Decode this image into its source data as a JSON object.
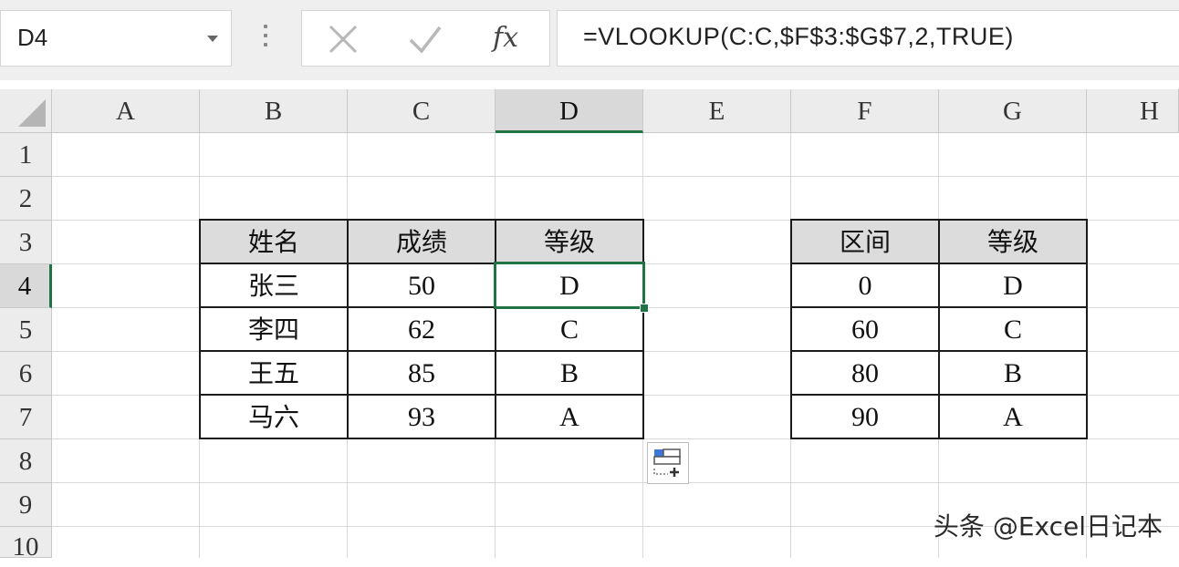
{
  "formula_bar": {
    "name_box": "D4",
    "fx_label": "fx",
    "formula": "=VLOOKUP(C:C,$F$3:$G$7,2,TRUE)"
  },
  "columns": [
    "A",
    "B",
    "C",
    "D",
    "E",
    "F",
    "G",
    "H"
  ],
  "rows": [
    "1",
    "2",
    "3",
    "4",
    "5",
    "6",
    "7",
    "8",
    "9",
    "10"
  ],
  "active_cell": "D4",
  "table_left": {
    "headers": [
      "姓名",
      "成绩",
      "等级"
    ],
    "rows": [
      [
        "张三",
        "50",
        "D"
      ],
      [
        "李四",
        "62",
        "C"
      ],
      [
        "王五",
        "85",
        "B"
      ],
      [
        "马六",
        "93",
        "A"
      ]
    ]
  },
  "table_right": {
    "headers": [
      "区间",
      "等级"
    ],
    "rows": [
      [
        "0",
        "D"
      ],
      [
        "60",
        "C"
      ],
      [
        "80",
        "B"
      ],
      [
        "90",
        "A"
      ]
    ]
  },
  "watermark": "头条 @Excel日记本",
  "colors": {
    "accent": "#217346",
    "header_fill": "#dcdcdc",
    "quick_analysis_blue": "#3c78d8"
  },
  "icons": {
    "cancel": "close-icon",
    "enter": "check-icon",
    "function": "fx-icon",
    "quick_analysis": "quick-analysis-icon"
  }
}
